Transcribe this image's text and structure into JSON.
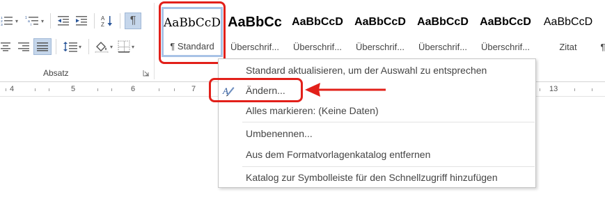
{
  "ribbon": {
    "paragraph_group_label": "Absatz",
    "styles": [
      {
        "sample": "AaBbCcD",
        "name": "¶ Standard",
        "selected": true
      },
      {
        "sample": "AaBbCc",
        "name": "Überschrif..."
      },
      {
        "sample": "AaBbCcD",
        "name": "Überschrif..."
      },
      {
        "sample": "AaBbCcD",
        "name": "Überschrif..."
      },
      {
        "sample": "AaBbCcD",
        "name": "Überschrif..."
      },
      {
        "sample": "AaBbCcD",
        "name": "Überschrif..."
      },
      {
        "sample": "AaBbCcD",
        "name": "Zitat"
      },
      {
        "sample": "",
        "name": "¶"
      }
    ],
    "selected_color": "#a8c3e6"
  },
  "ruler": {
    "numbers": [
      "4",
      "5",
      "6",
      "7",
      "13"
    ]
  },
  "context_menu": {
    "items": [
      {
        "label": "Standard aktualisieren, um der Auswahl zu entsprechen"
      },
      {
        "label": "Ändern..."
      },
      {
        "label": "Alles markieren: (Keine Daten)"
      },
      {
        "label": "Umbenennen..."
      },
      {
        "label": "Aus dem Formatvorlagenkatalog entfernen"
      },
      {
        "label": "Katalog zur Symbolleiste für den Schnellzugriff hinzufügen"
      }
    ]
  },
  "annotations": {
    "highlight_color": "#e2201a"
  }
}
